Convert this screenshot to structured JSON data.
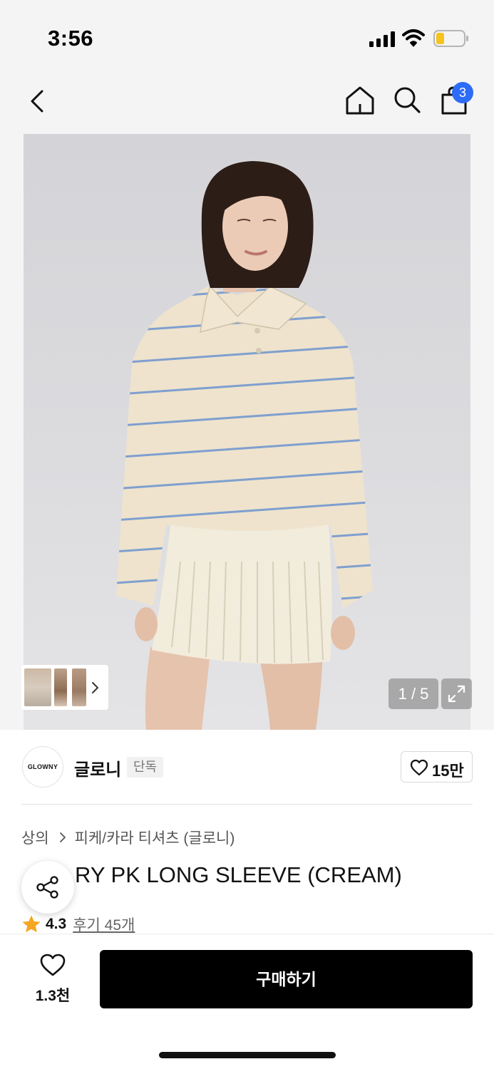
{
  "status_bar": {
    "time": "3:56",
    "icons": [
      "cellular-signal-icon",
      "wifi-icon",
      "battery-low-icon"
    ],
    "battery_color": "#f5c31c"
  },
  "nav": {
    "back_icon": "chevron-left-icon",
    "home_icon": "home-icon",
    "search_icon": "search-icon",
    "cart_icon": "shopping-bag-icon",
    "cart_badge": "3",
    "badge_color": "#2d6cf6"
  },
  "gallery": {
    "counter": "1 / 5",
    "expand_icon": "expand-icon",
    "thumbnail_arrow_icon": "chevron-right-icon"
  },
  "brand": {
    "logo_text": "GLOWNY",
    "name": "글로니",
    "tag": "단독",
    "like_icon": "heart-outline-icon",
    "like_count": "15만"
  },
  "product": {
    "breadcrumb": [
      "상의",
      "피케/카라 티셔츠 (글로니)"
    ],
    "title_visible": "RY PK LONG SLEEVE (CREAM)",
    "rating": "4.3",
    "reviews": "후기 45개",
    "rating_icon": "star-icon",
    "star_color": "#f5a623"
  },
  "share": {
    "icon": "share-icon"
  },
  "bottom_bar": {
    "wish_icon": "heart-outline-icon",
    "wish_count": "1.3천",
    "buy_label": "구매하기"
  }
}
